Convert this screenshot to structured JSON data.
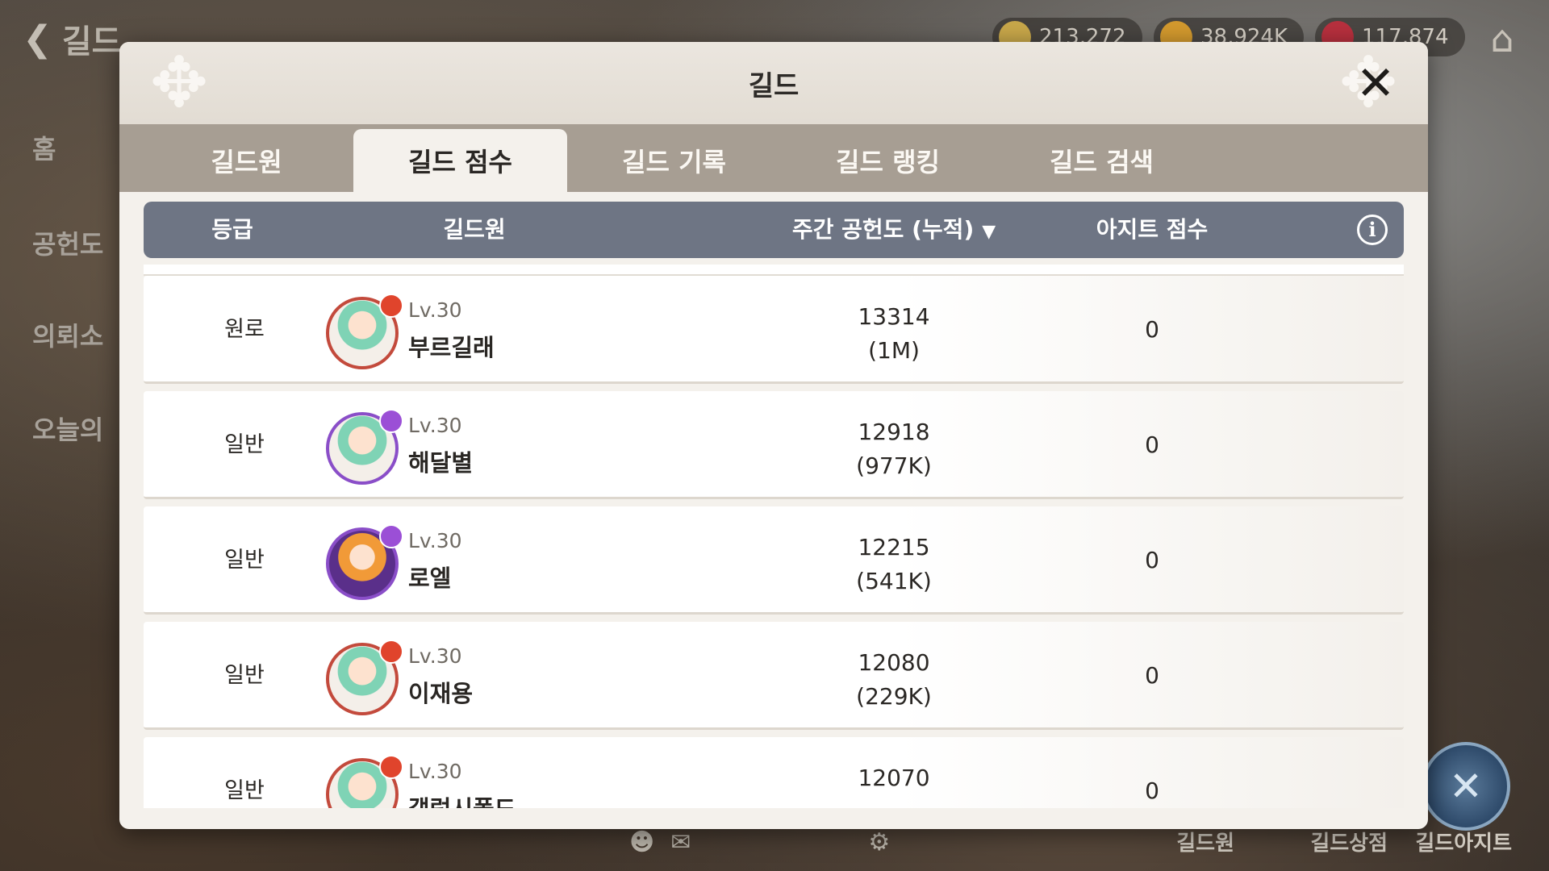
{
  "hud": {
    "back_label": "길드",
    "resources": [
      "213,272",
      "38,924K",
      "117,874"
    ]
  },
  "side_menu": [
    "홈",
    "공헌도",
    "의뢰소",
    "오늘의"
  ],
  "bottom_menu": [
    "길드원",
    "길드상점",
    "길드아지트"
  ],
  "modal": {
    "title": "길드",
    "tabs": [
      {
        "label": "길드원"
      },
      {
        "label": "길드 점수"
      },
      {
        "label": "길드 기록"
      },
      {
        "label": "길드 랭킹"
      },
      {
        "label": "길드 검색"
      }
    ],
    "active_tab": "길드 점수",
    "columns": {
      "grade": "등급",
      "member": "길드원",
      "weekly_contribution": "주간 공헌도 (누적)",
      "hideout_score": "아지트 점수"
    },
    "rows": [
      {
        "grade": "원로",
        "level": "Lv.30",
        "name": "부르길래",
        "score": "13314",
        "cumulative": "(1M)",
        "hideout": "0"
      },
      {
        "grade": "일반",
        "level": "Lv.30",
        "name": "해달별",
        "score": "12918",
        "cumulative": "(977K)",
        "hideout": "0"
      },
      {
        "grade": "일반",
        "level": "Lv.30",
        "name": "로엘",
        "score": "12215",
        "cumulative": "(541K)",
        "hideout": "0"
      },
      {
        "grade": "일반",
        "level": "Lv.30",
        "name": "이재용",
        "score": "12080",
        "cumulative": "(229K)",
        "hideout": "0"
      },
      {
        "grade": "일반",
        "level": "Lv.30",
        "name": "갤럭시폴드",
        "score": "12070",
        "cumulative": "",
        "hideout": "0"
      }
    ]
  }
}
